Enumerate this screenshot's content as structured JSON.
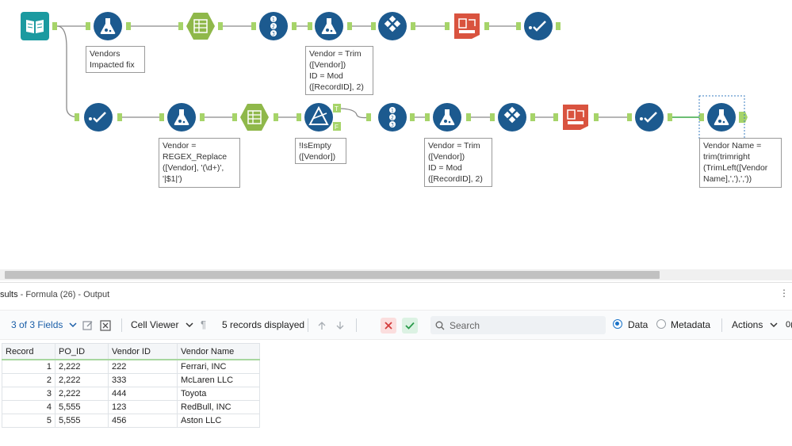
{
  "annotations": {
    "vendors_fix": "Vendors\nImpacted fix",
    "formula_top": "Vendor = Trim\n([Vendor])\nID = Mod\n([RecordID], 2)",
    "regex": "Vendor =\nREGEX_Replace\n([Vendor], '(\\d+)',\n'|$1|')",
    "filter": "!IsEmpty\n([Vendor])",
    "formula_mid": "Vendor = Trim\n([Vendor])\nID = Mod\n([RecordID], 2)",
    "formula_last": "Vendor Name =\ntrim(trimright\n(TrimLeft([Vendor\nName],','),','))"
  },
  "filter_anchors": {
    "true": "T",
    "false": "F"
  },
  "results": {
    "title_prefix": "sults",
    "title_rest": " - Formula (26) - Output",
    "more": "⋮"
  },
  "toolbar": {
    "fields": "3 of 3 Fields",
    "cell_viewer": "Cell Viewer",
    "records": "5 records displayed",
    "search_placeholder": "Search",
    "data": "Data",
    "metadata": "Metadata",
    "actions": "Actions",
    "overflow": "0("
  },
  "grid": {
    "columns": [
      "Record",
      "PO_ID",
      "Vendor ID",
      "Vendor Name"
    ],
    "rows": [
      [
        "1",
        "2,222",
        "222",
        "Ferrari, INC"
      ],
      [
        "2",
        "2,222",
        "333",
        "McLaren LLC"
      ],
      [
        "3",
        "2,222",
        "444",
        "Toyota"
      ],
      [
        "4",
        "5,555",
        "123",
        "RedBull, INC"
      ],
      [
        "5",
        "5,555",
        "456",
        "Aston LLC"
      ]
    ]
  },
  "colors": {
    "tool_blue": "#1c5a8f",
    "tool_green": "#8fb84a",
    "tool_teal": "#1b9aa0",
    "tool_red": "#d9533f",
    "connector": "#8a8a8a",
    "anchor": "#a6d469"
  }
}
